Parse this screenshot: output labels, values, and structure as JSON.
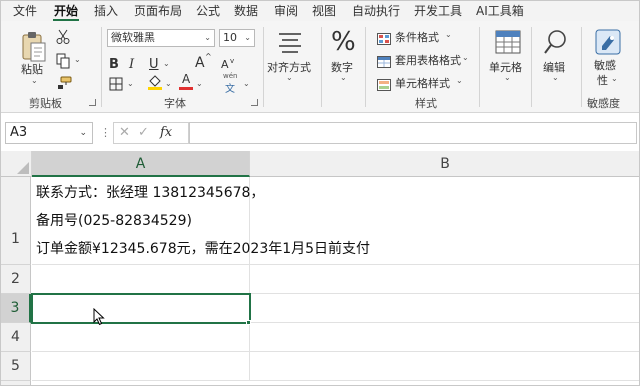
{
  "menu": {
    "tabs": [
      "文件",
      "开始",
      "插入",
      "页面布局",
      "公式",
      "数据",
      "审阅",
      "视图",
      "自动执行",
      "开发工具",
      "AI工具箱"
    ],
    "active": "开始"
  },
  "ribbon": {
    "clipboard": {
      "paste_label": "粘贴",
      "group_label": "剪贴板"
    },
    "font": {
      "font_name": "微软雅黑",
      "font_size": "10",
      "bold": "B",
      "italic": "I",
      "underline": "U",
      "grow": "A",
      "shrink": "A",
      "font_color_letter": "A",
      "phonetic": "wén",
      "group_label": "字体"
    },
    "alignment": {
      "label": "对齐方式"
    },
    "number": {
      "label": "数字"
    },
    "styles": {
      "conditional": "条件格式",
      "table_format": "套用表格格式",
      "cell_styles": "单元格样式",
      "group_label": "样式"
    },
    "cells": {
      "label": "单元格"
    },
    "editing": {
      "label": "编辑"
    },
    "sensitivity": {
      "label_line1": "敏感",
      "label_line2": "性",
      "group_label": "敏感度"
    }
  },
  "formula_bar": {
    "name_box": "A3",
    "fx": "fx",
    "formula": ""
  },
  "sheet": {
    "columns": [
      "A",
      "B"
    ],
    "rows": [
      "1",
      "2",
      "3",
      "4",
      "5"
    ],
    "cells": {
      "A1_line1": "联系方式：张经理 13812345678，",
      "A1_line2": "备用号(025-82834529)",
      "A1_line3": "订单金额¥12345.678元，需在2023年1月5日前支付"
    },
    "active_cell": "A3"
  },
  "colors": {
    "accent": "#217346",
    "ribbon_bg": "#f5f5f5",
    "header_bg": "#f0f0f0"
  }
}
